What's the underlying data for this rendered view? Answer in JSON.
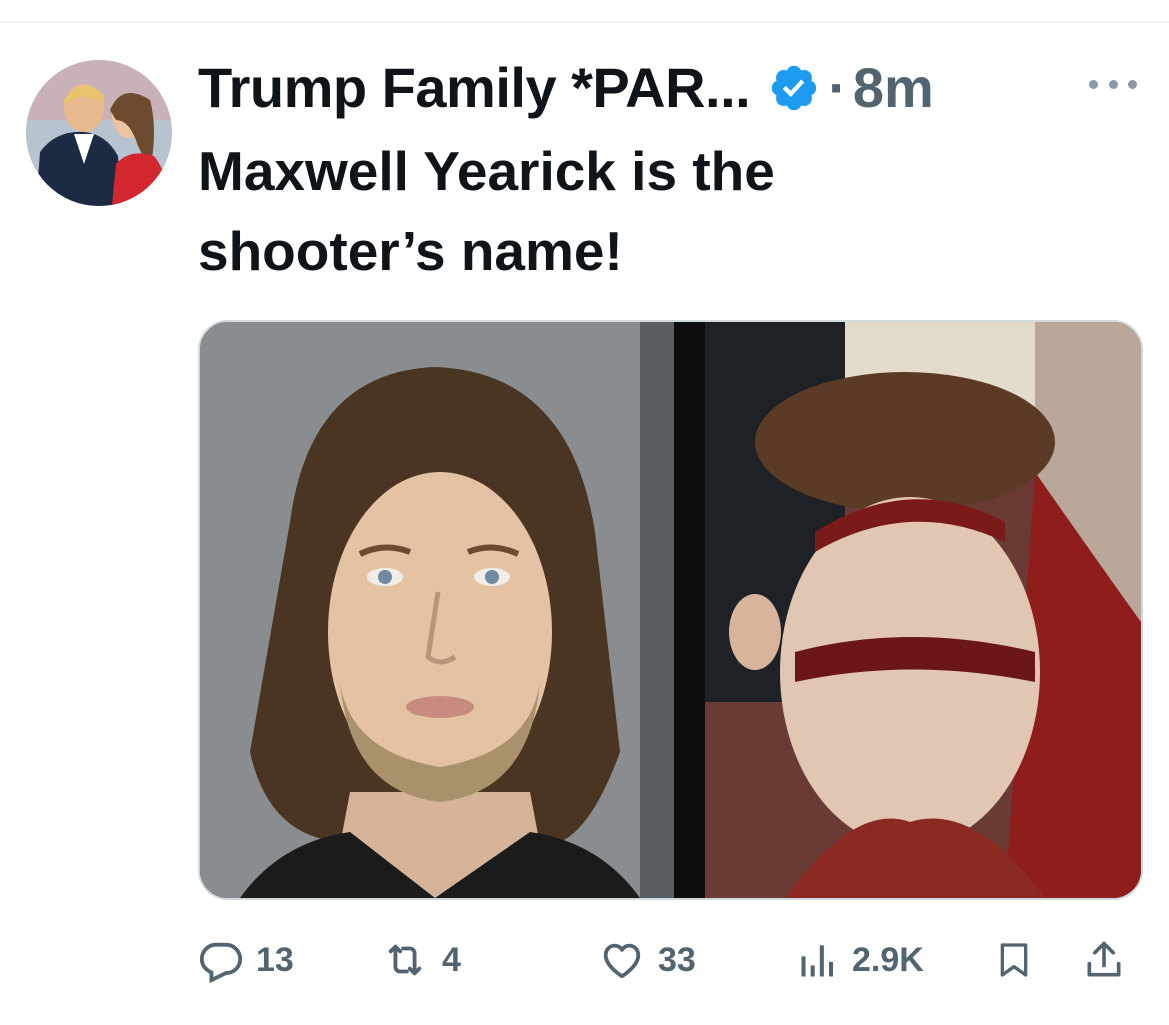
{
  "post": {
    "author_display_name": "Trump Family *PAR...",
    "verified": true,
    "separator": "·",
    "timestamp": "8m",
    "text_line1": "Maxwell Yearick is the",
    "text_line2": "shooter’s name!"
  },
  "actions": {
    "replies": "13",
    "reposts": "4",
    "likes": "33",
    "views": "2.9K"
  },
  "colors": {
    "verified_badge": "#1d9bf0",
    "secondary_text": "#536471",
    "primary_text": "#0f1419"
  },
  "icons": {
    "verified": "verified-badge-icon",
    "more": "more-icon",
    "reply": "reply-icon",
    "repost": "repost-icon",
    "like": "heart-icon",
    "views": "views-icon",
    "bookmark": "bookmark-icon",
    "share": "share-icon"
  }
}
